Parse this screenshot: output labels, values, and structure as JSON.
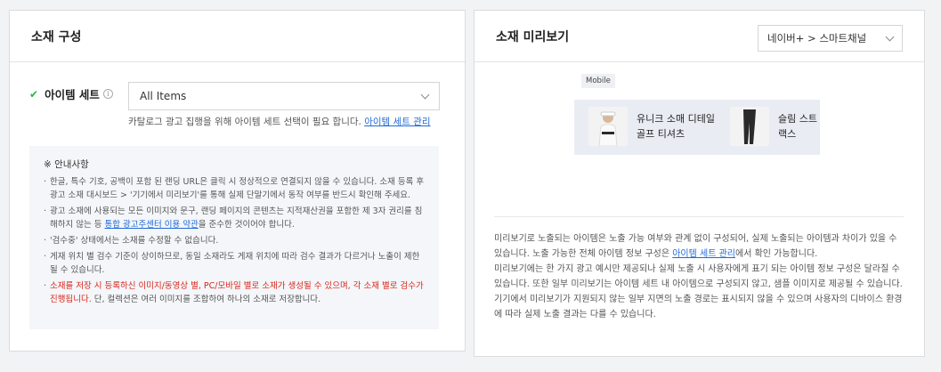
{
  "left": {
    "title": "소재 구성",
    "field_label": "아이템 세트",
    "select_value": "All Items",
    "hint_prefix": "카탈로그 광고 집행을 위해 아이템 세트 선택이 필요 합니다. ",
    "hint_link": "아이템 세트 관리",
    "notice_title": "※ 안내사항",
    "notices": [
      "한글, 특수 기호, 공백이 포함 된 랜딩 URL은 클릭 시 정상적으로 연결되지 않을 수 있습니다. 소재 등록 후 광고 소재 대시보드 > '기기에서 미리보기'를 통해 실제 단말기에서 동작 여부를 반드시 확인해 주세요.",
      "광고 소재에 사용되는 모든 이미지와 문구, 랜딩 페이지의 콘텐츠는 지적재산권을 포함한 제 3자 권리를 침해하지 않는 등 ",
      "'검수중' 상태에서는 소재를 수정할 수 없습니다.",
      "게재 위치 별 검수 기준이 상이하므로, 동일 소재라도 게재 위치에 따라 검수 결과가 다르거나 노출이 제한될 수 있습니다.",
      "소재를 저장 시 등록하신 이미지/동영상 별, PC/모바일 별로 소재가 생성될 수 있으며, 각 소재 별로 검수가 진행됩니다.",
      " 단, 컬렉션은 여러 이미지를 조합하여 하나의 소재로 저장합니다."
    ],
    "notice2_link": "통합 광고주센터 이용 약관",
    "notice2_suffix": "을 준수한 것이어야 합니다."
  },
  "right": {
    "title": "소재 미리보기",
    "select_value": "네이버+ > 스마트채널",
    "badge": "Mobile",
    "cards": [
      {
        "line1": "유니크 소매 디테일",
        "line2": "골프 티셔츠"
      },
      {
        "line1": "슬림 스트",
        "line2": "랙스"
      }
    ],
    "desc1_prefix": "미리보기로 노출되는 아이템은 노출 가능 여부와 관계 없이 구성되어, 실제 노출되는 아이템과 차이가 있을 수 있습니다. 노출 가능한 전체 아이템 정보 구성은 ",
    "desc1_link": "아이템 세트 관리",
    "desc1_suffix": "에서 확인 가능합니다.",
    "desc2": "미리보기에는 한 가지 광고 예시만 제공되나 실제 노출 시 사용자에게 표기 되는 아이템 정보 구성은 달라질 수 있습니다. 또한 일부 미리보기는 아이템 세트 내 아이템으로 구성되지 않고, 샘플 이미지로 제공될 수 있습니다.",
    "desc3": "기기에서 미리보기가 지원되지 않는 일부 지면의 노출 경로는 표시되지 않을 수 있으며 사용자의 디바이스 환경에 따라 실제 노출 결과는 다를 수 있습니다."
  },
  "colors": {
    "accent_link": "#1f6ad9",
    "check": "#2ab34a",
    "warning": "#d9261c"
  }
}
